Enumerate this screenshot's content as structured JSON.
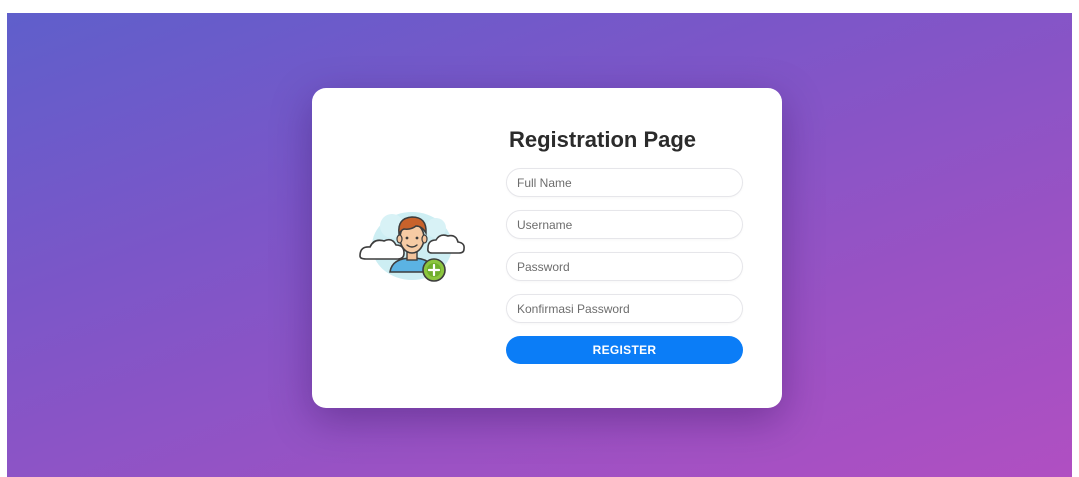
{
  "page": {
    "title": "Registration Page"
  },
  "form": {
    "full_name_placeholder": "Full Name",
    "username_placeholder": "Username",
    "password_placeholder": "Password",
    "confirm_password_placeholder": "Konfirmasi Password",
    "register_label": "REGISTER"
  },
  "illustration": {
    "icon": "add-user-icon"
  },
  "colors": {
    "background_start": "#5f5fcb",
    "background_end": "#b04fc2",
    "button": "#0b7df7",
    "card": "#ffffff"
  }
}
